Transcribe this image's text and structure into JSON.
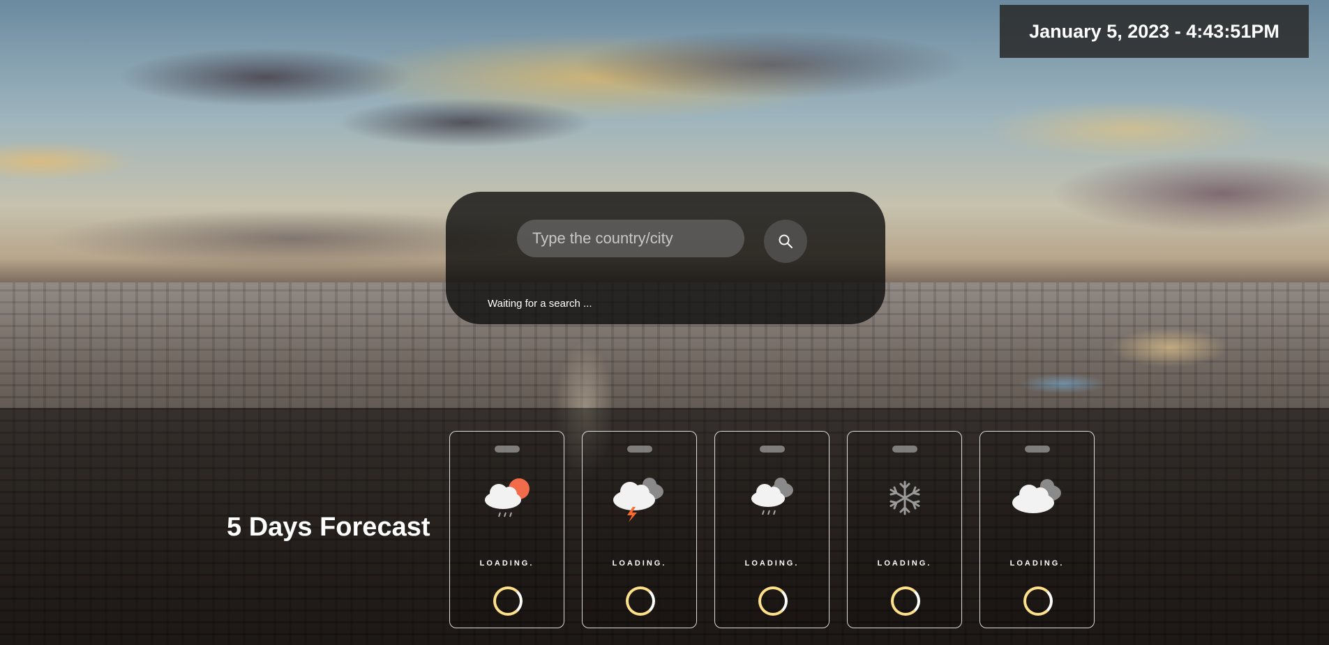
{
  "header": {
    "datetime": "January 5, 2023 - 4:43:51PM"
  },
  "search": {
    "placeholder": "Type the country/city",
    "status": "Waiting for a search ...",
    "button_icon": "search-icon"
  },
  "forecast": {
    "title": "5 Days Forecast",
    "cards": [
      {
        "icon": "partly-sunny-rain-icon",
        "loading": "LOADING."
      },
      {
        "icon": "thunderstorm-icon",
        "loading": "LOADING."
      },
      {
        "icon": "cloud-rain-icon",
        "loading": "LOADING."
      },
      {
        "icon": "snowflake-icon",
        "loading": "LOADING."
      },
      {
        "icon": "cloudy-icon",
        "loading": "LOADING."
      }
    ]
  },
  "colors": {
    "spinner": "#ffe08a",
    "sun": "#f26b4a",
    "bolt": "#ff6a2a"
  }
}
